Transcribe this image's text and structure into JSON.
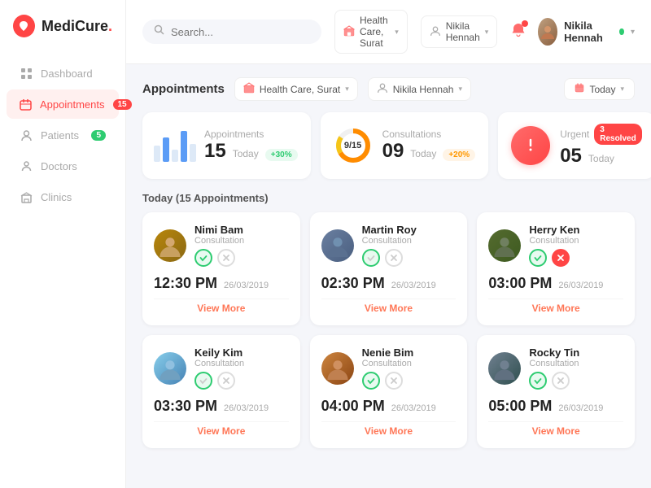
{
  "logo": {
    "text": "MediCure",
    "dot": "."
  },
  "nav": {
    "items": [
      {
        "id": "dashboard",
        "label": "Dashboard",
        "icon": "grid-icon",
        "active": false,
        "badge": null
      },
      {
        "id": "appointments",
        "label": "Appointments",
        "icon": "calendar-icon",
        "active": true,
        "badge": "15"
      },
      {
        "id": "patients",
        "label": "Patients",
        "icon": "user-icon",
        "active": false,
        "badge": "5"
      },
      {
        "id": "doctors",
        "label": "Doctors",
        "icon": "doctor-icon",
        "active": false,
        "badge": null
      },
      {
        "id": "clinics",
        "label": "Clinics",
        "icon": "clinic-icon",
        "active": false,
        "badge": null
      }
    ]
  },
  "header": {
    "search_placeholder": "Search...",
    "filter1": {
      "label": "Health Care, Surat",
      "icon": "home-icon"
    },
    "filter2": {
      "label": "Nikila Hennah",
      "icon": "user-filter-icon"
    },
    "date_filter": "Today",
    "user": {
      "name": "Nikila Hennah",
      "online": true
    }
  },
  "page_title": "Appointments",
  "stats": [
    {
      "label": "Appointments",
      "value": "15",
      "sub": "Today",
      "badge": "+30%",
      "badge_type": "green",
      "visual": "bar-chart"
    },
    {
      "label": "Consultations",
      "value": "09",
      "sub": "Today",
      "badge": "+20%",
      "badge_type": "orange",
      "visual": "donut",
      "donut_current": 9,
      "donut_total": 15
    },
    {
      "label": "Urgent",
      "value": "05",
      "sub": "Today",
      "badge": "3 Resolved",
      "badge_type": "red-badge",
      "visual": "urgent"
    }
  ],
  "today_label": "Today (15 Appointments)",
  "appointments": [
    {
      "name": "Nimi Bam",
      "type": "Consultation",
      "time": "12:30 PM",
      "date": "26/03/2019",
      "check": true,
      "cross_red": false,
      "avatar_class": "av-nimi",
      "view_more": "View More"
    },
    {
      "name": "Martin Roy",
      "type": "Consultation",
      "time": "02:30 PM",
      "date": "26/03/2019",
      "check": false,
      "cross_red": false,
      "avatar_class": "av-martin",
      "view_more": "View More"
    },
    {
      "name": "Herry Ken",
      "type": "Consultation",
      "time": "03:00 PM",
      "date": "26/03/2019",
      "check": true,
      "cross_red": true,
      "avatar_class": "av-herry",
      "view_more": "View More"
    },
    {
      "name": "Keily Kim",
      "type": "Consultation",
      "time": "03:30 PM",
      "date": "26/03/2019",
      "check": false,
      "cross_red": false,
      "avatar_class": "av-keily",
      "view_more": "View More"
    },
    {
      "name": "Nenie Bim",
      "type": "Consultation",
      "time": "04:00 PM",
      "date": "26/03/2019",
      "check": true,
      "cross_red": false,
      "avatar_class": "av-nenie",
      "view_more": "View More"
    },
    {
      "name": "Rocky Tin",
      "type": "Consultation",
      "time": "05:00 PM",
      "date": "26/03/2019",
      "check": true,
      "cross_red": false,
      "avatar_class": "av-rocky",
      "view_more": "View More"
    }
  ]
}
